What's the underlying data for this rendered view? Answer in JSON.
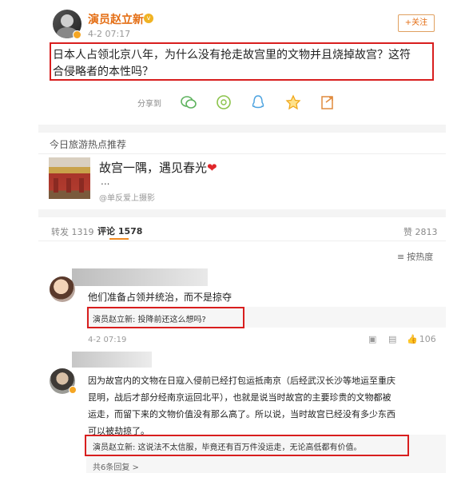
{
  "post": {
    "author": "演员赵立新",
    "time": "4-2 07:17",
    "follow_label": "+关注",
    "text_line1": "日本人占领北京八年，为什么没有抢走故宫里的文物并且烧掉故宫？这符",
    "text_line2": "合侵略者的本性吗？"
  },
  "share": {
    "label": "分享到",
    "icons": [
      "wechat-icon",
      "moments-icon",
      "qq-icon",
      "qzone-icon",
      "export-icon"
    ]
  },
  "recommend": {
    "section_title": "今日旅游热点推荐",
    "card_title": "故宫一隅，遇见春光",
    "card_ellipsis": "...",
    "card_source": "@单反爱上摄影"
  },
  "tabs": {
    "repost": "转发 1319",
    "comments": "评论 1578",
    "likes": "赞 2813",
    "sort": "按热度"
  },
  "comments": [
    {
      "text": "他们准备占领并统治，而不是掠夺",
      "reply": "演员赵立新: 投降前还这么想吗?",
      "time": "4-2 07:19",
      "like_count": "106"
    },
    {
      "text_line1": "因为故宫内的文物在日寇入侵前已经打包运抵南京（后经武汉长沙等地运至重庆",
      "text_line2": "昆明，战后才部分经南京运回北平），也就是说当时故宫的主要珍贵的文物都被",
      "text_line3": "运走，而留下来的文物价值没有那么高了。所以说，当时故宫已经没有多少东西",
      "text_line4": "可以被劫掠了。",
      "reply": "演员赵立新: 这说法不太信服，毕竟还有百万件没运走，无论高低都有价值。",
      "more_replies": "共6条回复 >"
    }
  ],
  "colors": {
    "author": "#e46e14",
    "highlight_border": "#d81e1e",
    "reply_name": "#eb7350"
  }
}
